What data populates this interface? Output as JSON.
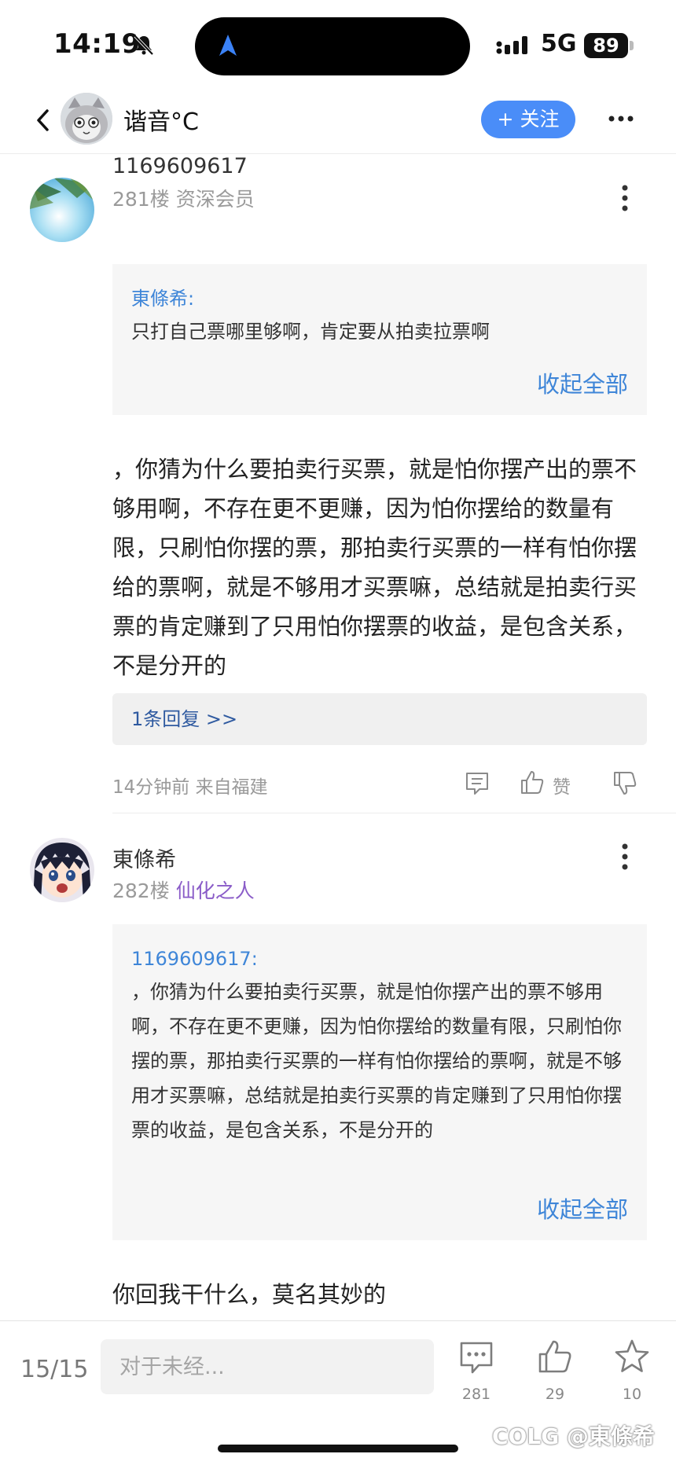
{
  "status_bar": {
    "time": "14:19",
    "network": "5G",
    "battery": "89"
  },
  "nav": {
    "title": "谐音°C",
    "follow_label": "+ 关注"
  },
  "posts": [
    {
      "username": "1169609617",
      "floor": "281楼",
      "level": "资深会员",
      "quote_author": "東條希:",
      "quote_text": "只打自己票哪里够啊，肯定要从拍卖拉票啊",
      "collapse_label": "收起全部",
      "body": "，你猜为什么要拍卖行买票，就是怕你摆产出的票不够用啊，不存在更不更赚，因为怕你摆给的数量有限，只刷怕你摆的票，那拍卖行买票的一样有怕你摆给的票啊，就是不够用才买票嘛，总结就是拍卖行买票的肯定赚到了只用怕你摆票的收益，是包含关系，不是分开的",
      "replies_label": "1条回复 >>",
      "meta": "14分钟前 来自福建",
      "like_label": "赞"
    },
    {
      "username": "東條希",
      "floor": "282楼",
      "level": "仙化之人",
      "quote_author": "1169609617:",
      "quote_text": "，你猜为什么要拍卖行买票，就是怕你摆产出的票不够用啊，不存在更不更赚，因为怕你摆给的数量有限，只刷怕你摆的票，那拍卖行买票的一样有怕你摆给的票啊，就是不够用才买票嘛，总结就是拍卖行买票的肯定赚到了只用怕你摆票的收益，是包含关系，不是分开的",
      "collapse_label": "收起全部",
      "body": "你回我干什么，莫名其妙的"
    }
  ],
  "bottom_bar": {
    "page": "15/15",
    "reply_placeholder": "对于未经...",
    "comment_count": "281",
    "like_count": "29",
    "star_count": "10"
  },
  "watermark": "COLG @東條希",
  "colors": {
    "accent_blue": "#4a8df8",
    "link_blue": "#3f86d8",
    "purple_badge": "#8a5cc8"
  }
}
